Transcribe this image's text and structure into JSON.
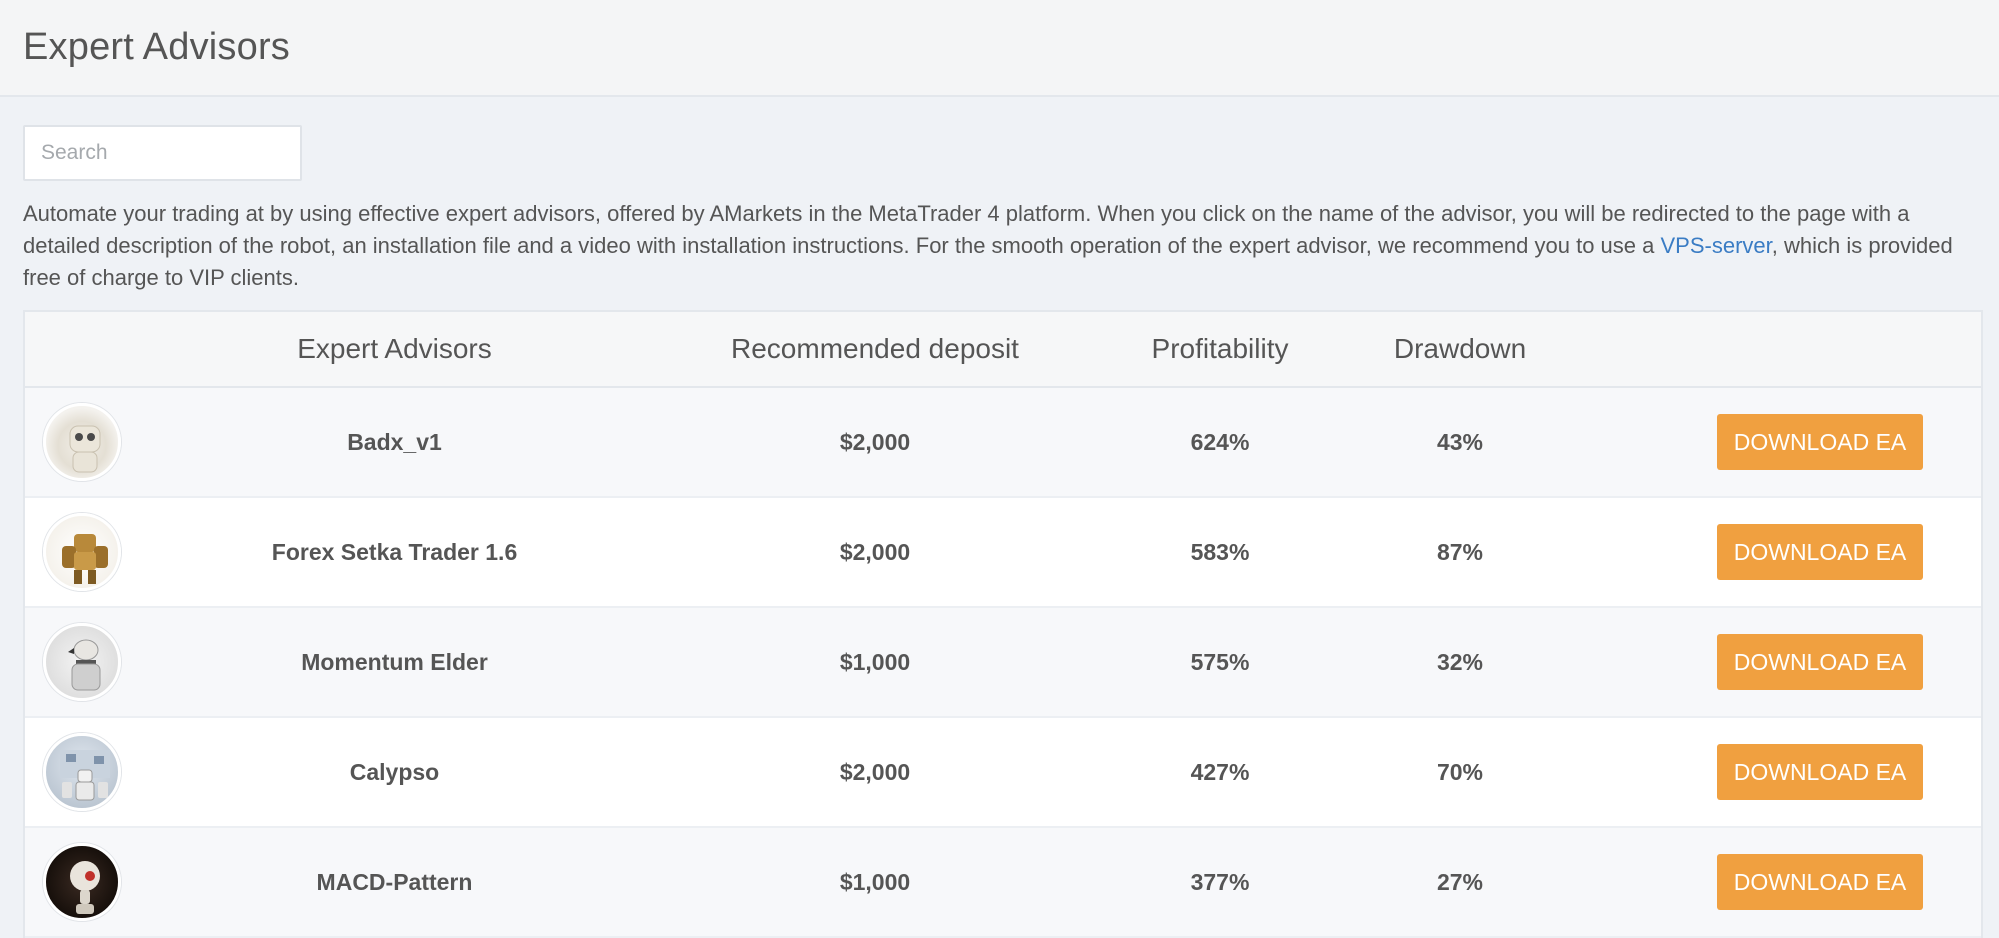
{
  "header": {
    "title": "Expert Advisors"
  },
  "search": {
    "placeholder": "Search"
  },
  "intro": {
    "text_before_link": "Automate your trading at by using effective expert advisors, offered by AMarkets in the MetaTrader 4 platform. When you click on the name of the advisor, you will be redirected to the page with a detailed description of the robot, an installation file and a video with installation instructions. For the smooth operation of the expert advisor, we recommend you to use a ",
    "link_text": "VPS-server",
    "text_after_link": ", which is provided free of charge to VIP clients."
  },
  "table": {
    "columns": {
      "name": "Expert Advisors",
      "deposit": "Recommended deposit",
      "profitability": "Profitability",
      "drawdown": "Drawdown"
    },
    "rows": [
      {
        "name": "Badx_v1",
        "deposit": "$2,000",
        "profitability": "624%",
        "drawdown": "43%",
        "button": "DOWNLOAD EA",
        "avatar_icon": "white-robot-icon"
      },
      {
        "name": "Forex Setka Trader 1.6",
        "deposit": "$2,000",
        "profitability": "583%",
        "drawdown": "87%",
        "button": "DOWNLOAD EA",
        "avatar_icon": "golden-mech-robot-icon"
      },
      {
        "name": "Momentum Elder",
        "deposit": "$1,000",
        "profitability": "575%",
        "drawdown": "32%",
        "button": "DOWNLOAD EA",
        "avatar_icon": "grey-robot-icon"
      },
      {
        "name": "Calypso",
        "deposit": "$2,000",
        "profitability": "427%",
        "drawdown": "70%",
        "button": "DOWNLOAD EA",
        "avatar_icon": "robots-group-icon"
      },
      {
        "name": "MACD-Pattern",
        "deposit": "$1,000",
        "profitability": "377%",
        "drawdown": "27%",
        "button": "DOWNLOAD EA",
        "avatar_icon": "red-eye-robot-icon"
      }
    ]
  },
  "colors": {
    "accent_button": "#f0a040",
    "link": "#3a7cc4",
    "background": "#eff2f6"
  }
}
